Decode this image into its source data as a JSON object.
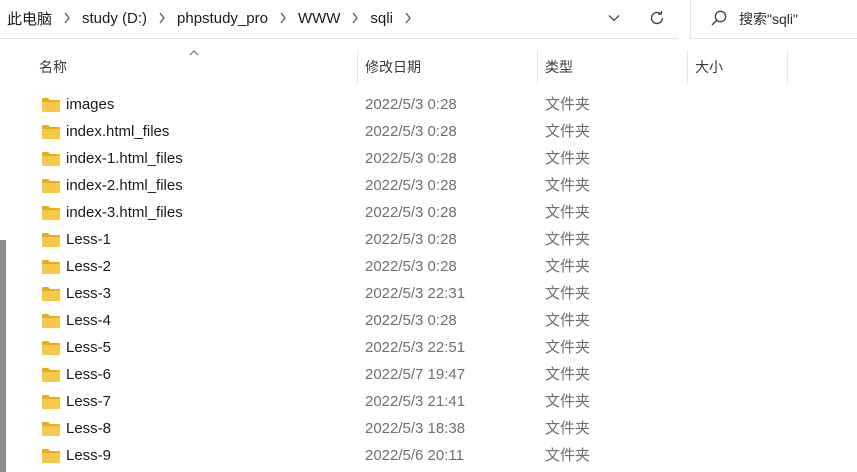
{
  "address": {
    "breadcrumbs": [
      "此电脑",
      "study (D:)",
      "phpstudy_pro",
      "WWW",
      "sqli"
    ]
  },
  "search": {
    "placeholder": "搜索\"sqli\""
  },
  "columns": {
    "name": "名称",
    "date": "修改日期",
    "type": "类型",
    "size": "大小"
  },
  "files": [
    {
      "name": "images",
      "date": "2022/5/3 0:28",
      "type": "文件夹"
    },
    {
      "name": "index.html_files",
      "date": "2022/5/3 0:28",
      "type": "文件夹"
    },
    {
      "name": "index-1.html_files",
      "date": "2022/5/3 0:28",
      "type": "文件夹"
    },
    {
      "name": "index-2.html_files",
      "date": "2022/5/3 0:28",
      "type": "文件夹"
    },
    {
      "name": "index-3.html_files",
      "date": "2022/5/3 0:28",
      "type": "文件夹"
    },
    {
      "name": "Less-1",
      "date": "2022/5/3 0:28",
      "type": "文件夹"
    },
    {
      "name": "Less-2",
      "date": "2022/5/3 0:28",
      "type": "文件夹"
    },
    {
      "name": "Less-3",
      "date": "2022/5/3 22:31",
      "type": "文件夹"
    },
    {
      "name": "Less-4",
      "date": "2022/5/3 0:28",
      "type": "文件夹"
    },
    {
      "name": "Less-5",
      "date": "2022/5/3 22:51",
      "type": "文件夹"
    },
    {
      "name": "Less-6",
      "date": "2022/5/7 19:47",
      "type": "文件夹"
    },
    {
      "name": "Less-7",
      "date": "2022/5/3 21:41",
      "type": "文件夹"
    },
    {
      "name": "Less-8",
      "date": "2022/5/3 18:38",
      "type": "文件夹"
    },
    {
      "name": "Less-9",
      "date": "2022/5/6 20:11",
      "type": "文件夹"
    }
  ],
  "colors": {
    "folder": "#f7c948",
    "folder_dark": "#e8ad1e",
    "header_text": "#3a3a3a",
    "muted_text": "#6f6f6f"
  }
}
